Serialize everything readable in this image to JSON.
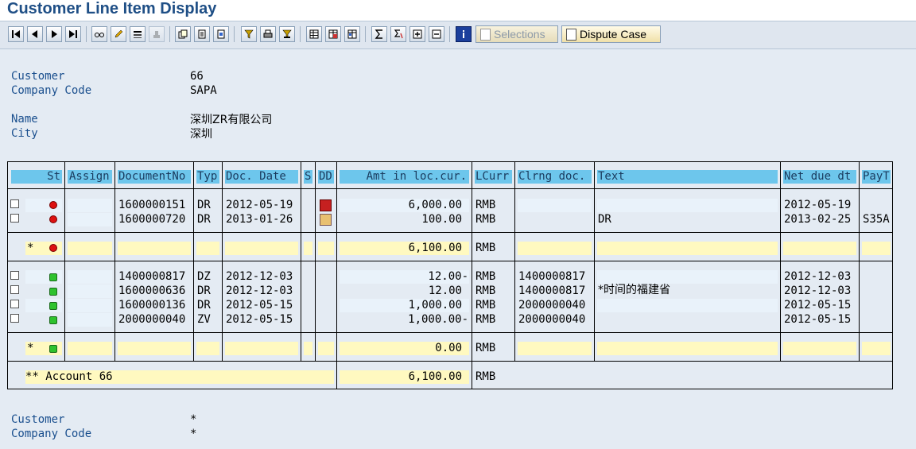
{
  "window": {
    "title": "Customer Line Item Display"
  },
  "toolbar": {
    "selections_label": "Selections",
    "dispute_label": "Dispute Case"
  },
  "header": {
    "customer_label": "Customer",
    "customer_value": "66",
    "company_label": "Company Code",
    "company_value": "SAPA",
    "name_label": "Name",
    "name_value": "深圳ZR有限公司",
    "city_label": "City",
    "city_value": "深圳"
  },
  "table": {
    "columns": [
      "St",
      "Assign",
      "DocumentNo",
      "Typ",
      "Doc. Date",
      "S",
      "DD",
      "Amt in loc.cur.",
      "LCurr",
      "Clrng doc.",
      "Text",
      "Net due dt",
      "PayT"
    ],
    "rows": [
      {
        "doc": "1600000151",
        "typ": "DR",
        "date": "2012-05-19",
        "amt": "6,000.00",
        "curr": "RMB",
        "clr": "",
        "text": "",
        "net": "2012-05-19",
        "payt": ""
      },
      {
        "doc": "1600000720",
        "typ": "DR",
        "date": "2013-01-26",
        "amt": "100.00",
        "curr": "RMB",
        "clr": "",
        "text": "DR",
        "net": "2013-02-25",
        "payt": "S35A"
      },
      {
        "doc": "1400000817",
        "typ": "DZ",
        "date": "2012-12-03",
        "amt": "12.00-",
        "curr": "RMB",
        "clr": "1400000817",
        "text": "",
        "net": "2012-12-03",
        "payt": ""
      },
      {
        "doc": "1600000636",
        "typ": "DR",
        "date": "2012-12-03",
        "amt": "12.00",
        "curr": "RMB",
        "clr": "1400000817",
        "text": "*时间的福建省",
        "net": "2012-12-03",
        "payt": ""
      },
      {
        "doc": "1600000136",
        "typ": "DR",
        "date": "2012-05-15",
        "amt": "1,000.00",
        "curr": "RMB",
        "clr": "2000000040",
        "text": "",
        "net": "2012-05-15",
        "payt": ""
      },
      {
        "doc": "2000000040",
        "typ": "ZV",
        "date": "2012-05-15",
        "amt": "1,000.00-",
        "curr": "RMB",
        "clr": "2000000040",
        "text": "",
        "net": "2012-05-15",
        "payt": ""
      }
    ],
    "subtotal1": {
      "star": "*",
      "amt": "6,100.00",
      "curr": "RMB"
    },
    "subtotal2": {
      "star": "*",
      "amt": "0.00",
      "curr": "RMB"
    },
    "account_total": {
      "label": "** Account 66",
      "amt": "6,100.00",
      "curr": "RMB"
    }
  },
  "footer": {
    "customer_label": "Customer",
    "customer_value": "*",
    "company_label": "Company Code",
    "company_value": "*"
  }
}
